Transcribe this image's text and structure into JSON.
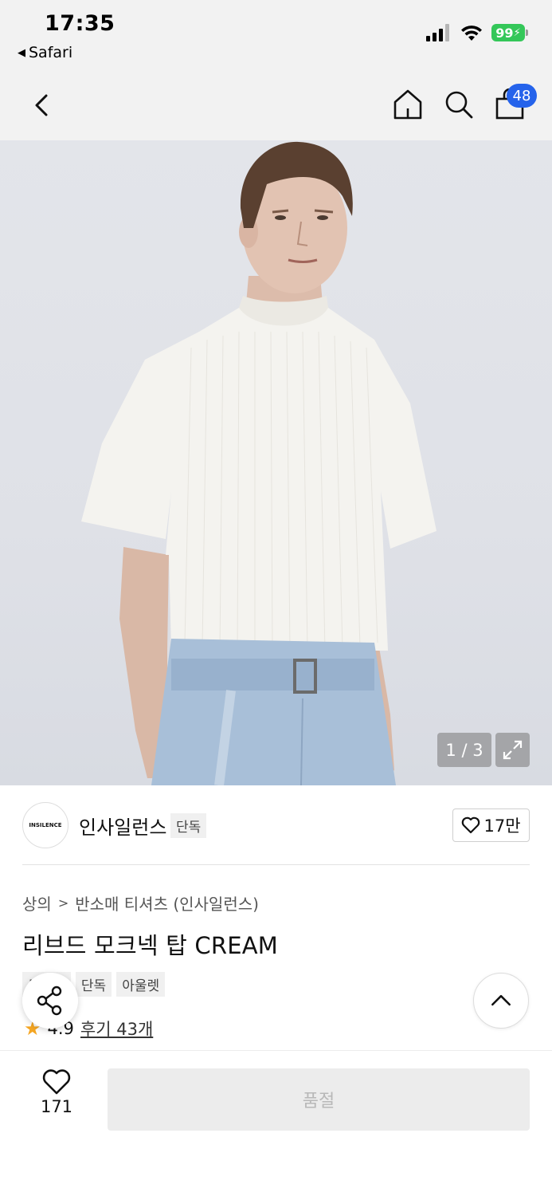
{
  "status_bar": {
    "time": "17:35",
    "back_app": "Safari",
    "battery": "99"
  },
  "nav": {
    "cart_count": "48"
  },
  "gallery": {
    "counter": "1 / 3"
  },
  "brand": {
    "logo_text": "INSILENCE",
    "name": "인사일런스",
    "tag": "단독",
    "like_count": "17만"
  },
  "product": {
    "breadcrumb": [
      "상의",
      "반소매 티셔츠 (인사일런스)"
    ],
    "title": "리브드 모크넥 탑 CREAM",
    "tags": [
      "무신사",
      "단독",
      "아울렛"
    ],
    "rating": "4.9",
    "review_link": "후기 43개"
  },
  "bottom": {
    "wish_count": "171",
    "buy_label": "품절"
  },
  "colors": {
    "accent_badge": "#2563eb",
    "battery": "#34c759",
    "star": "#f5a623"
  }
}
